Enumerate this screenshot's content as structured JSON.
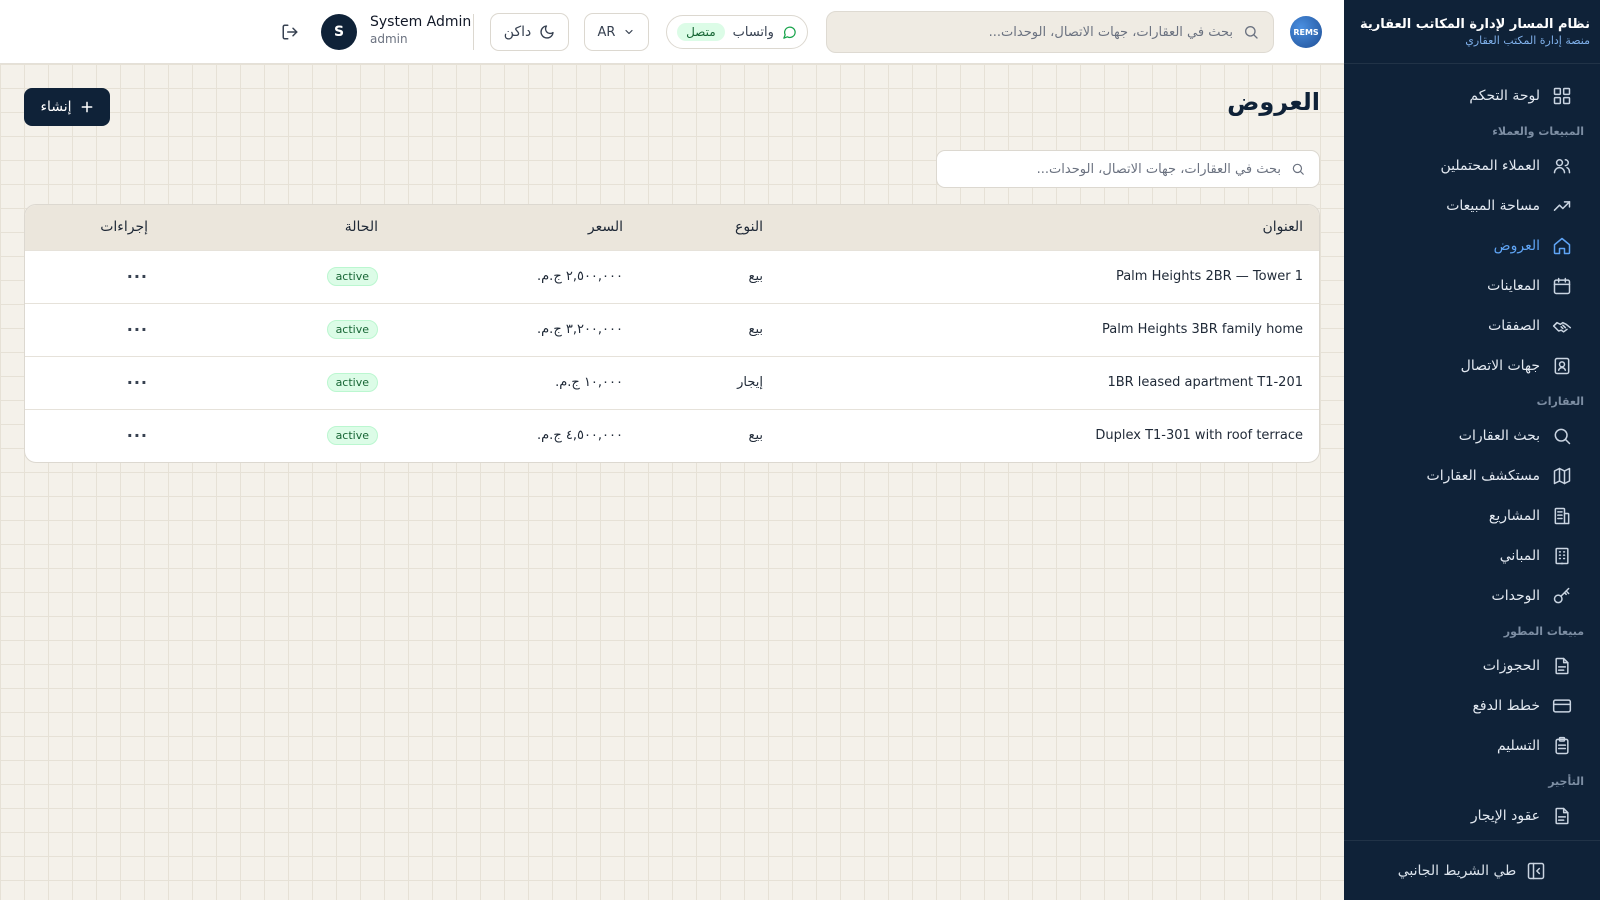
{
  "brand": {
    "logo_text": "REMS",
    "title": "نظام المسار لإدارة المكاتب العقارية",
    "subtitle": "منصة إدارة المكتب العقاري"
  },
  "sidebar": {
    "items": [
      {
        "type": "item",
        "label": "لوحة التحكم",
        "icon": "dashboard-grid-icon"
      },
      {
        "type": "section",
        "label": "المبيعات والعملاء"
      },
      {
        "type": "item",
        "label": "العملاء المحتملين",
        "icon": "users-icon"
      },
      {
        "type": "item",
        "label": "مساحة المبيعات",
        "icon": "trending-up-icon"
      },
      {
        "type": "item",
        "label": "العروض",
        "icon": "home-icon",
        "active": true
      },
      {
        "type": "item",
        "label": "المعاينات",
        "icon": "calendar-icon"
      },
      {
        "type": "item",
        "label": "الصفقات",
        "icon": "handshake-icon"
      },
      {
        "type": "item",
        "label": "جهات الاتصال",
        "icon": "contact-card-icon"
      },
      {
        "type": "section",
        "label": "العقارات"
      },
      {
        "type": "item",
        "label": "بحث العقارات",
        "icon": "search-icon"
      },
      {
        "type": "item",
        "label": "مستكشف العقارات",
        "icon": "map-icon"
      },
      {
        "type": "item",
        "label": "المشاريع",
        "icon": "buildings-icon"
      },
      {
        "type": "item",
        "label": "المباني",
        "icon": "building-icon"
      },
      {
        "type": "item",
        "label": "الوحدات",
        "icon": "key-icon"
      },
      {
        "type": "section",
        "label": "مبيعات المطور"
      },
      {
        "type": "item",
        "label": "الحجوزات",
        "icon": "document-icon"
      },
      {
        "type": "item",
        "label": "خطط الدفع",
        "icon": "credit-card-icon"
      },
      {
        "type": "item",
        "label": "التسليم",
        "icon": "clipboard-icon"
      },
      {
        "type": "section",
        "label": "التأجير"
      },
      {
        "type": "item",
        "label": "عقود الإيجار",
        "icon": "document-icon"
      }
    ],
    "collapse_label": "طي الشريط الجانبي"
  },
  "topbar": {
    "search_placeholder": "بحث في العقارات، جهات الاتصال، الوحدات...",
    "whatsapp_label": "واتساب",
    "whatsapp_status": "متصل",
    "language": "AR",
    "theme_label": "داكن",
    "user_name": "System Admin",
    "user_role": "admin",
    "user_initial": "S"
  },
  "page": {
    "title": "العروض",
    "create_label": "إنشاء",
    "search_placeholder": "بحث في العقارات، جهات الاتصال، الوحدات..."
  },
  "table": {
    "headers": {
      "title": "العنوان",
      "type": "النوع",
      "price": "السعر",
      "status": "الحالة",
      "actions": "إجراءات"
    },
    "rows": [
      {
        "title": "Palm Heights 2BR — Tower 1",
        "type": "بيع",
        "price": "٢,٥٠٠,٠٠٠ ج.م.",
        "status": "active",
        "actions": "···"
      },
      {
        "title": "Palm Heights 3BR family home",
        "type": "بيع",
        "price": "٣,٢٠٠,٠٠٠ ج.م.",
        "status": "active",
        "actions": "···"
      },
      {
        "title": "1BR leased apartment T1-201",
        "type": "إيجار",
        "price": "١٠,٠٠٠ ج.م.",
        "status": "active",
        "actions": "···"
      },
      {
        "title": "Duplex T1-301 with roof terrace",
        "type": "بيع",
        "price": "٤,٥٠٠,٠٠٠ ج.م.",
        "status": "active",
        "actions": "···"
      }
    ]
  },
  "colors": {
    "sidebar_bg": "#0f2238",
    "accent": "#5fa4f4",
    "primary_button": "#0f2238",
    "status_active_bg": "#dcfce7",
    "status_active_text": "#166534",
    "page_bg": "#f4f1ea"
  }
}
